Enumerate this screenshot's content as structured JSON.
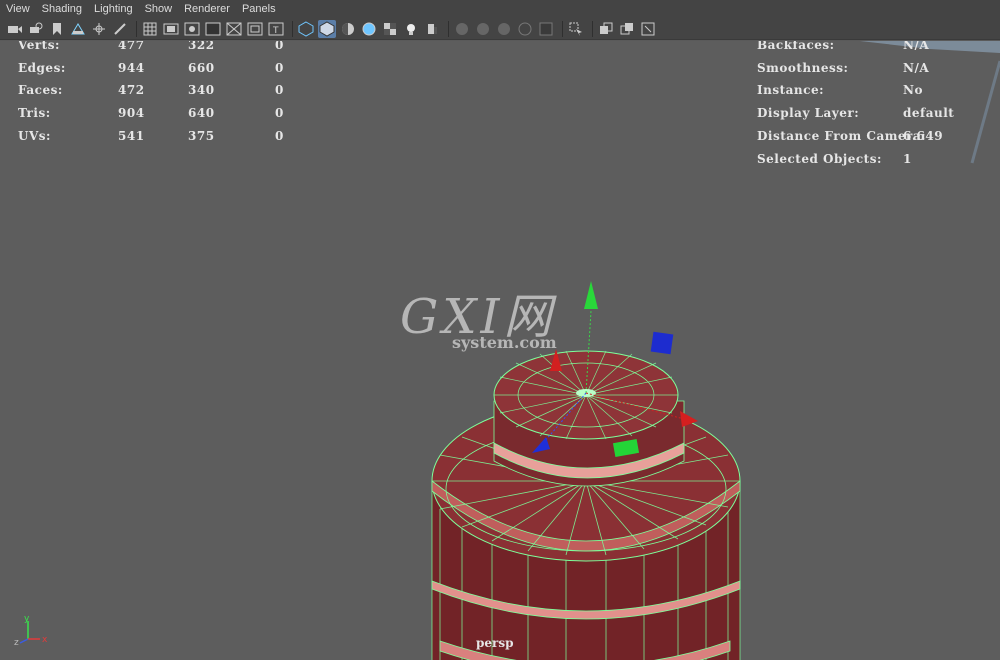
{
  "menu": [
    "View",
    "Shading",
    "Lighting",
    "Show",
    "Renderer",
    "Panels"
  ],
  "toolbar": {
    "icons": [
      "camera-icon",
      "camera-attributes-icon",
      "bookmark-icon",
      "image-plane-icon",
      "pivot-icon",
      "brush-icon",
      "grid-icon",
      "film-gate-icon",
      "resolution-gate-icon",
      "gate-mask-icon",
      "field-chart-icon",
      "safe-action-icon",
      "safe-title-icon",
      "wireframe-icon",
      "smooth-shade-icon",
      "wireframe-on-shaded-icon",
      "xray-icon",
      "textured-icon",
      "use-lights-icon",
      "shadows-icon",
      "ambient-occlusion-icon",
      "motion-blur-icon",
      "antialias-icon",
      "depth-of-field-icon",
      "isolate-select-icon",
      "xray-joints-icon",
      "two-sided-lighting-icon",
      "hud-icon"
    ]
  },
  "hud_left": {
    "rows": [
      {
        "label": "Verts:",
        "a": "477",
        "b": "322",
        "c": "0"
      },
      {
        "label": "Edges:",
        "a": "944",
        "b": "660",
        "c": "0"
      },
      {
        "label": "Faces:",
        "a": "472",
        "b": "340",
        "c": "0"
      },
      {
        "label": "Tris:",
        "a": "904",
        "b": "640",
        "c": "0"
      },
      {
        "label": "UVs:",
        "a": "541",
        "b": "375",
        "c": "0"
      }
    ]
  },
  "hud_right": {
    "rows": [
      {
        "label": "Backfaces:",
        "value": "N/A"
      },
      {
        "label": "Smoothness:",
        "value": "N/A"
      },
      {
        "label": "Instance:",
        "value": "No"
      },
      {
        "label": "Display Layer:",
        "value": "default"
      },
      {
        "label": "Distance From Camera:",
        "value": "6.649"
      },
      {
        "label": "Selected Objects:",
        "value": "1"
      }
    ]
  },
  "camera": "persp",
  "watermark": {
    "big": "GXI网",
    "small": "system.com"
  },
  "axis": {
    "y": "y",
    "z": "z",
    "x": "x"
  },
  "colors": {
    "mesh_fill": "#7a2a2e",
    "wire": "#7dff9a",
    "bg": "#5d5d5d"
  }
}
